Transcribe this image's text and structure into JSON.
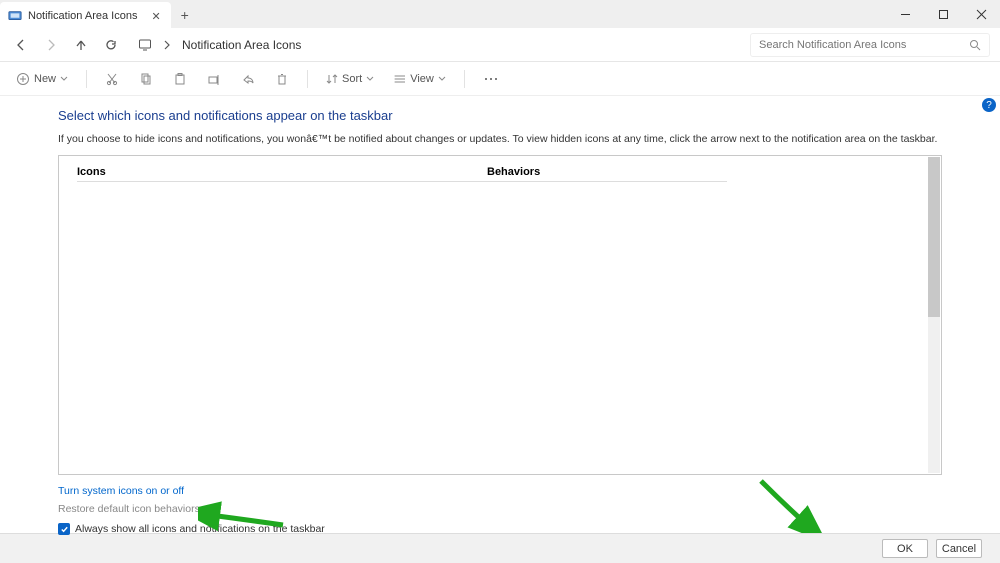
{
  "titlebar": {
    "tab_title": "Notification Area Icons",
    "new_tab_tooltip": "+"
  },
  "addrbar": {
    "title": "Notification Area Icons",
    "search_placeholder": "Search Notification Area Icons"
  },
  "toolbar": {
    "new_label": "New",
    "sort_label": "Sort",
    "view_label": "View"
  },
  "page": {
    "heading": "Select which icons and notifications appear on the taskbar",
    "subtext": "If you choose to hide icons and notifications, you wonâ€™t be notified about changes or updates. To view hidden icons at any time, click the arrow next to the notification area on the taskbar.",
    "col_icons": "Icons",
    "col_behaviors": "Behaviors",
    "link_system_icons": "Turn system icons on or off",
    "link_restore": "Restore default icon behaviors",
    "checkbox_label": "Always show all icons and notifications on the taskbar",
    "help_char": "?"
  },
  "footer": {
    "ok": "OK",
    "cancel": "Cancel"
  }
}
